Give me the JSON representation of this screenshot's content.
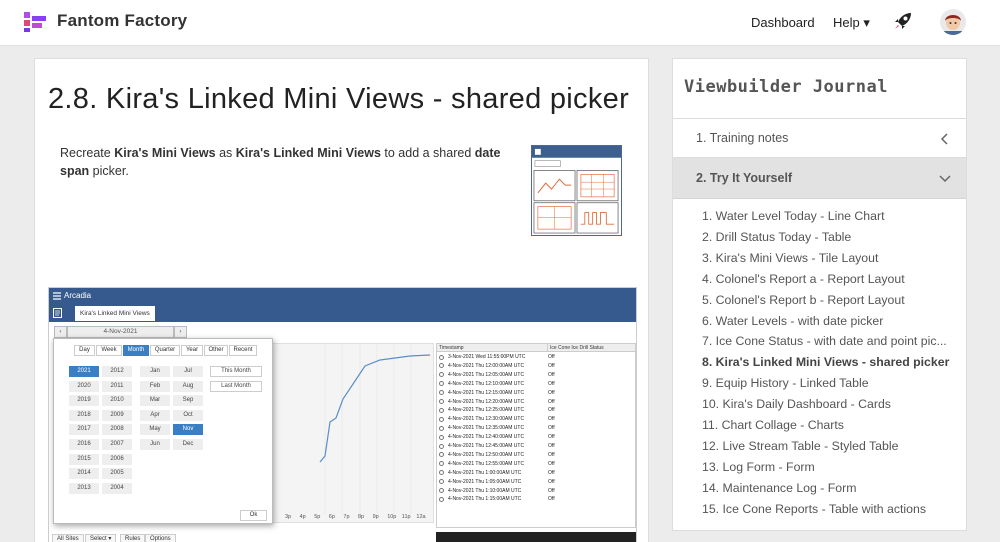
{
  "header": {
    "brand": "Fantom Factory",
    "nav_dashboard": "Dashboard",
    "nav_help": "Help ▾",
    "accent": "#7b3fe0"
  },
  "main": {
    "title": "2.8. Kira's Linked Mini Views - shared picker",
    "intro": [
      {
        "text": "Recreate ",
        "bold": false
      },
      {
        "text": "Kira's Mini Views",
        "bold": true
      },
      {
        "text": " as ",
        "bold": false
      },
      {
        "text": "Kira's Linked Mini Views",
        "bold": true
      },
      {
        "text": " to add a shared ",
        "bold": false
      },
      {
        "text": "date span",
        "bold": true
      },
      {
        "text": " picker.",
        "bold": false
      }
    ],
    "screenshot": {
      "app_name": "Arcadia",
      "tab_label": "Kira's Linked Mini Views",
      "date_value": "4-Nov-2021",
      "picker_tabs": [
        "Day",
        "Week",
        "Month",
        "Quarter",
        "Year",
        "Other",
        "Recent"
      ],
      "picker_active_tab": "Month",
      "years_col1": [
        "2021",
        "2020",
        "2019",
        "2018",
        "2017",
        "2016",
        "2015",
        "2014",
        "2013"
      ],
      "years_col2": [
        "2012",
        "2011",
        "2010",
        "2009",
        "2008",
        "2007",
        "2006",
        "2005",
        "2004"
      ],
      "months_col1": [
        "Jan",
        "Feb",
        "Mar",
        "Apr",
        "May",
        "Jun"
      ],
      "months_col2": [
        "Jul",
        "Aug",
        "Sep",
        "Oct",
        "Nov",
        "Dec"
      ],
      "selected_year": "2021",
      "selected_month": "Nov",
      "quick_picks": [
        "This Month",
        "Last Month"
      ],
      "ok_label": "Ok",
      "x_labels": [
        "3p",
        "4p",
        "5p",
        "6p",
        "7p",
        "8p",
        "9p",
        "10p",
        "11p",
        "12a"
      ],
      "table_headers": [
        "Timestamp",
        "Ice Cone Ice Drill Status"
      ],
      "table_rows": [
        [
          "3-Nov-2021 Wed 11:55:00PM UTC",
          "Off"
        ],
        [
          "4-Nov-2021 Thu 12:00:00AM UTC",
          "Off"
        ],
        [
          "4-Nov-2021 Thu 12:05:00AM UTC",
          "Off"
        ],
        [
          "4-Nov-2021 Thu 12:10:00AM UTC",
          "Off"
        ],
        [
          "4-Nov-2021 Thu 12:15:00AM UTC",
          "Off"
        ],
        [
          "4-Nov-2021 Thu 12:20:00AM UTC",
          "Off"
        ],
        [
          "4-Nov-2021 Thu 12:25:00AM UTC",
          "Off"
        ],
        [
          "4-Nov-2021 Thu 12:30:00AM UTC",
          "Off"
        ],
        [
          "4-Nov-2021 Thu 12:35:00AM UTC",
          "Off"
        ],
        [
          "4-Nov-2021 Thu 12:40:00AM UTC",
          "Off"
        ],
        [
          "4-Nov-2021 Thu 12:45:00AM UTC",
          "Off"
        ],
        [
          "4-Nov-2021 Thu 12:50:00AM UTC",
          "Off"
        ],
        [
          "4-Nov-2021 Thu 12:55:00AM UTC",
          "Off"
        ],
        [
          "4-Nov-2021 Thu 1:00:00AM UTC",
          "Off"
        ],
        [
          "4-Nov-2021 Thu 1:05:00AM UTC",
          "Off"
        ],
        [
          "4-Nov-2021 Thu 1:10:00AM UTC",
          "Off"
        ],
        [
          "4-Nov-2021 Thu 1:15:00AM UTC",
          "Off"
        ]
      ],
      "footer_buttons": [
        "All Sites",
        "Select ▾",
        "Rules",
        "Options"
      ]
    }
  },
  "sidebar": {
    "title": "Viewbuilder Journal",
    "section1": "1. Training notes",
    "section2": "2. Try It Yourself",
    "items": [
      "1. Water Level Today - Line Chart",
      "2. Drill Status Today - Table",
      "3. Kira's Mini Views - Tile Layout",
      "4. Colonel's Report a - Report Layout",
      "5. Colonel's Report b - Report Layout",
      "6. Water Levels - with date picker",
      "7. Ice Cone Status - with date and point pic...",
      "8. Kira's Linked Mini Views - shared picker",
      "9. Equip History - Linked Table",
      "10. Kira's Daily Dashboard - Cards",
      "11. Chart Collage - Charts",
      "12. Live Stream Table - Styled Table",
      "13. Log Form - Form",
      "14. Maintenance Log - Form",
      "15. Ice Cone Reports - Table with actions"
    ],
    "active_index": 7
  }
}
